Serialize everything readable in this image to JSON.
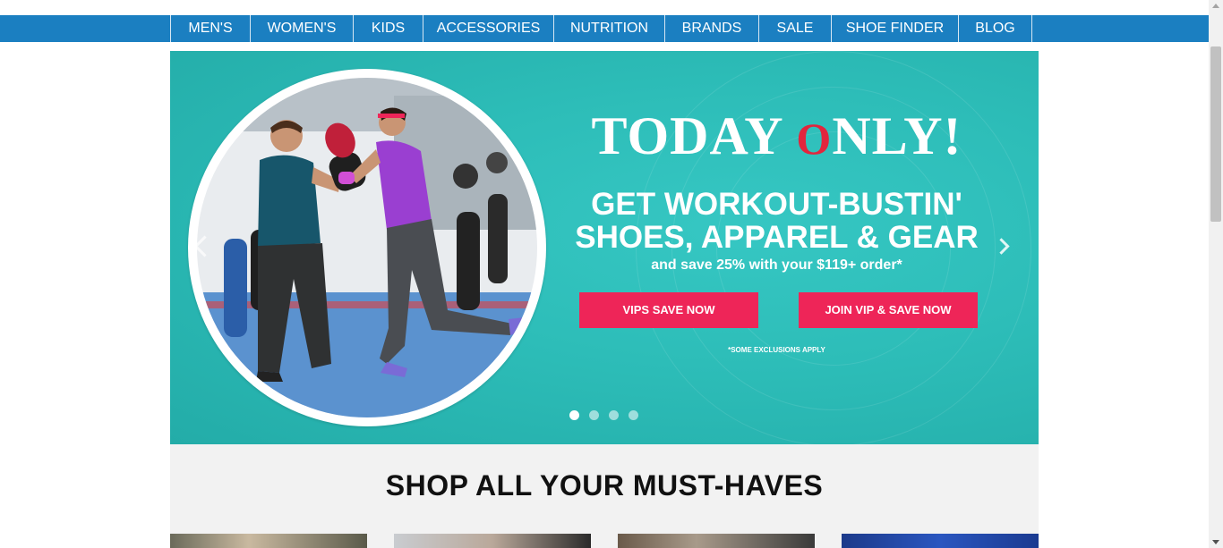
{
  "nav": {
    "items": [
      {
        "label": "MEN'S"
      },
      {
        "label": "WOMEN'S"
      },
      {
        "label": "KIDS"
      },
      {
        "label": "ACCESSORIES"
      },
      {
        "label": "NUTRITION"
      },
      {
        "label": "BRANDS"
      },
      {
        "label": "SALE"
      },
      {
        "label": "SHOE FINDER"
      },
      {
        "label": "BLOG"
      }
    ]
  },
  "hero": {
    "today_prefix": "TODAY ",
    "today_o": "O",
    "today_suffix": "NLY!",
    "headline_line1": "GET WORKOUT-BUSTIN'",
    "headline_line2": "SHOES, APPAREL & GEAR",
    "subline": "and save 25% with your $119+ order*",
    "vip_button": "VIPS SAVE NOW",
    "join_button": "JOIN VIP & SAVE NOW",
    "disclaimer": "*SOME EXCLUSIONS APPLY",
    "slide_count": 4,
    "active_slide": 1
  },
  "shop": {
    "title": "SHOP ALL YOUR MUST-HAVES"
  },
  "colors": {
    "nav_blue": "#1b7fc1",
    "hero_teal": "#2dbdb8",
    "cta_pink": "#ee2558",
    "today_o_red": "#e2253d"
  }
}
